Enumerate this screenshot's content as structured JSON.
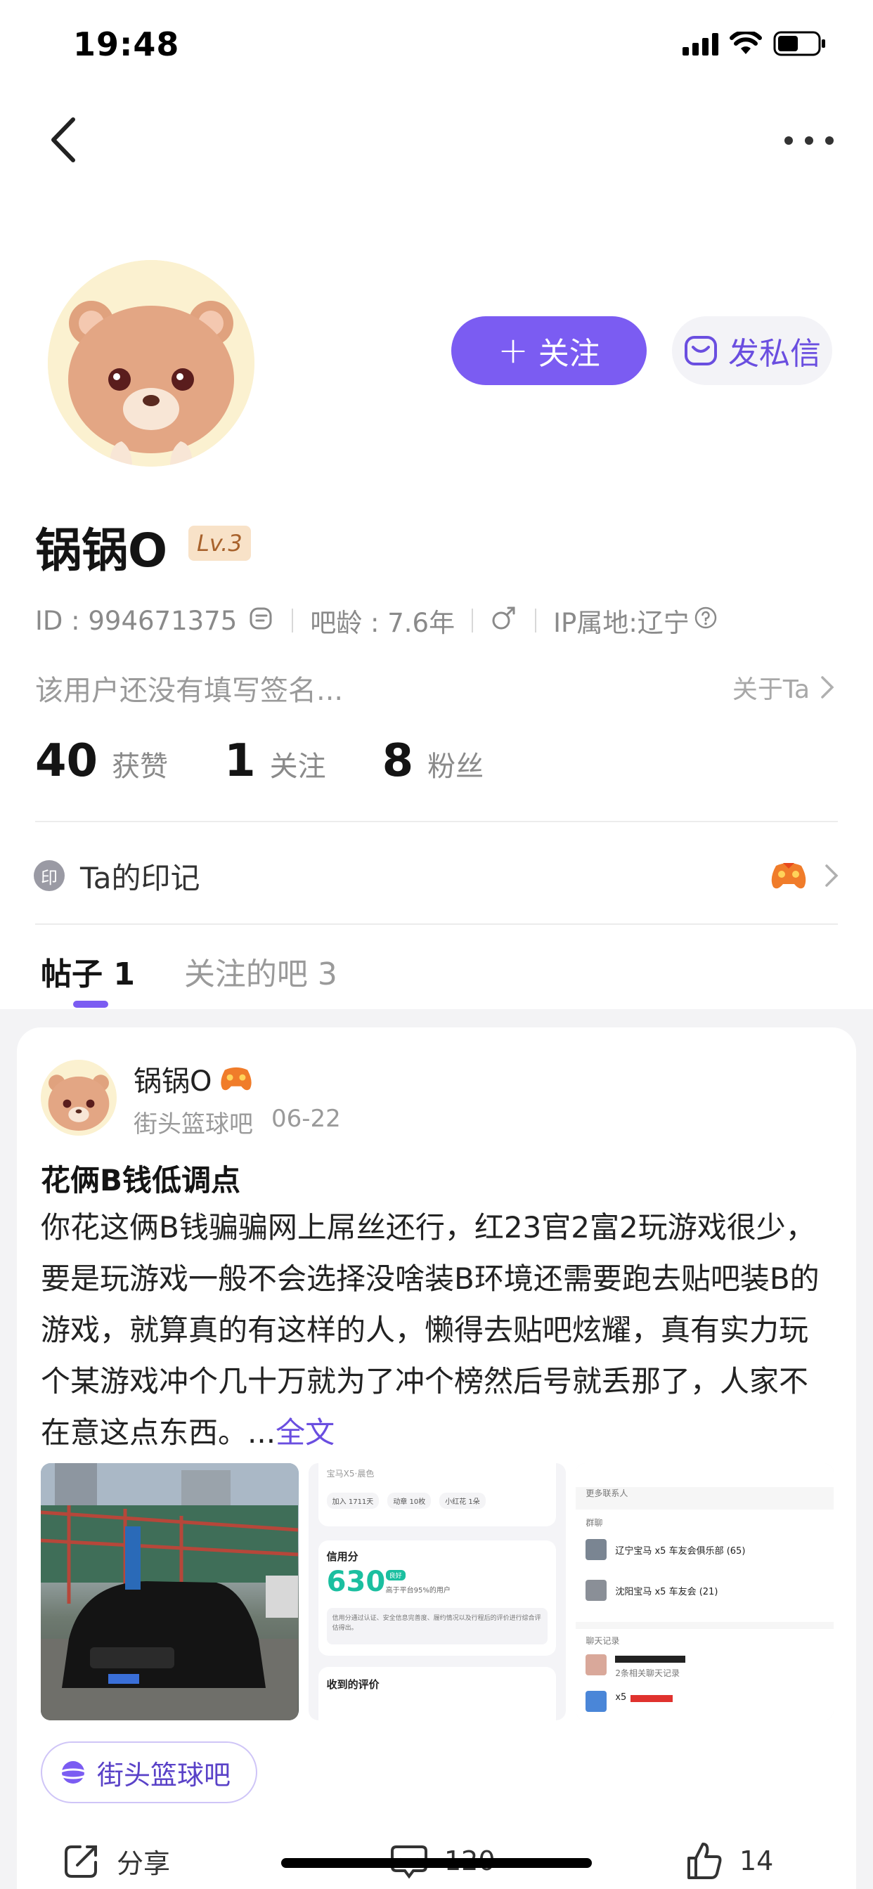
{
  "status": {
    "time": "19:48"
  },
  "profile": {
    "follow_label": "关注",
    "message_label": "发私信",
    "username": "锅锅O",
    "level": "Lv.3",
    "id_text": "ID : 994671375",
    "bar_age": "吧龄 : 7.6年",
    "ip_location": "IP属地:辽宁",
    "signature": "该用户还没有填写签名...",
    "about_label": "关于Ta",
    "stats": [
      {
        "num": "40",
        "label": "获赞"
      },
      {
        "num": "1",
        "label": "关注"
      },
      {
        "num": "8",
        "label": "粉丝"
      }
    ],
    "badge_title": "Ta的印记",
    "badge_stamp": "印"
  },
  "tabs": [
    {
      "label": "帖子 1"
    },
    {
      "label": "关注的吧 3"
    }
  ],
  "post": {
    "author": "锅锅O",
    "forum": "街头篮球吧",
    "date": "06-22",
    "title": "花俩B钱低调点",
    "body": "你花这俩B钱骗骗网上屌丝还行，红23官2富2玩游戏很少，要是玩游戏一般不会选择没啥装B环境还需要跑去贴吧装B的游戏，就算真的有这样的人，懒得去贴吧炫耀，真有实力玩个某游戏冲个几十万就为了冲个榜然后号就丢那了，人家不在意这点东西。...",
    "read_more": "全文",
    "forum_tag": "街头篮球吧",
    "share_label": "分享",
    "comment_count": "120",
    "like_count": "14",
    "thumb2": {
      "series_label": "宝马X5·晨色",
      "pills": [
        "加入 1711天",
        "动章 10枚",
        "小红花 1朵"
      ],
      "credit_title": "信用分",
      "credit_score": "630",
      "credit_tag": "良好",
      "credit_desc": "高于平台95%的用户",
      "credit_note": "信用分通过认证、安全信息完善度、履约情况以及行程后的评价进行综合评估得出。",
      "review_title": "收到的评价"
    },
    "thumb3": {
      "more_contacts": "更多联系人",
      "group_header": "群聊",
      "groups": [
        "辽宁宝马 x5 车友会俱乐部 (65)",
        "沈阳宝马 x5 车友会 (21)"
      ],
      "chat_header": "聊天记录",
      "chat_record": "2条相关聊天记录",
      "chat_name": "x5"
    }
  },
  "colors": {
    "accent": "#7b5cf2",
    "message_text": "#6a4ee0"
  }
}
